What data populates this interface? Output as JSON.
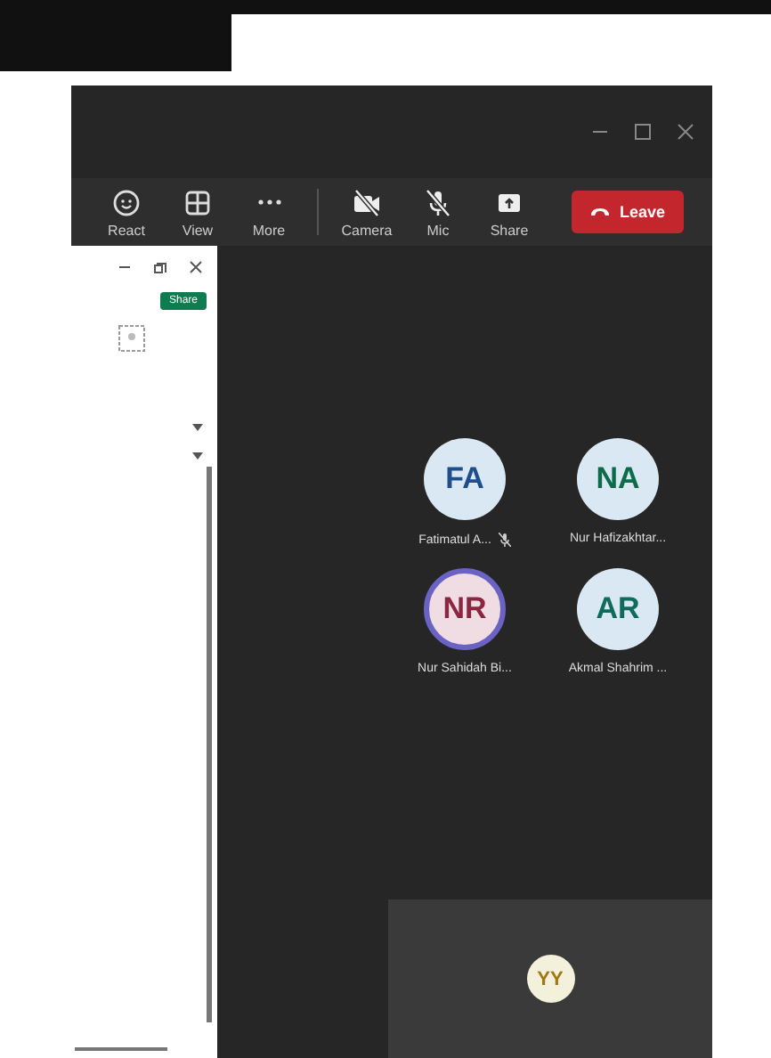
{
  "toolbar": [
    {
      "label": "React",
      "kind": "react",
      "off": false
    },
    {
      "label": "View",
      "kind": "view",
      "off": false
    },
    {
      "label": "More",
      "kind": "more",
      "off": false
    },
    {
      "label": "Camera",
      "kind": "camera",
      "off": true
    },
    {
      "label": "Mic",
      "kind": "mic",
      "off": true
    },
    {
      "label": "Share",
      "kind": "share",
      "off": false
    }
  ],
  "leave_button": {
    "label": "Leave"
  },
  "side_panel": {
    "share_button": {
      "label": "Share"
    }
  },
  "participants": [
    {
      "initials": "FA",
      "name": "Fatimatul A...",
      "muted": true,
      "speaking": false,
      "color": "#1f4e8c"
    },
    {
      "initials": "NA",
      "name": "Nur Hafizakhtar...",
      "muted": false,
      "speaking": false,
      "color": "#0e6b4a"
    },
    {
      "initials": "NR",
      "name": "Nur Sahidah Bi...",
      "muted": false,
      "speaking": true,
      "color": "#8a2640"
    },
    {
      "initials": "AR",
      "name": "Akmal Shahrim ...",
      "muted": false,
      "speaking": false,
      "color": "#0f6b5c"
    }
  ],
  "self_view": {
    "initials": "YY",
    "color": "#a07812"
  }
}
